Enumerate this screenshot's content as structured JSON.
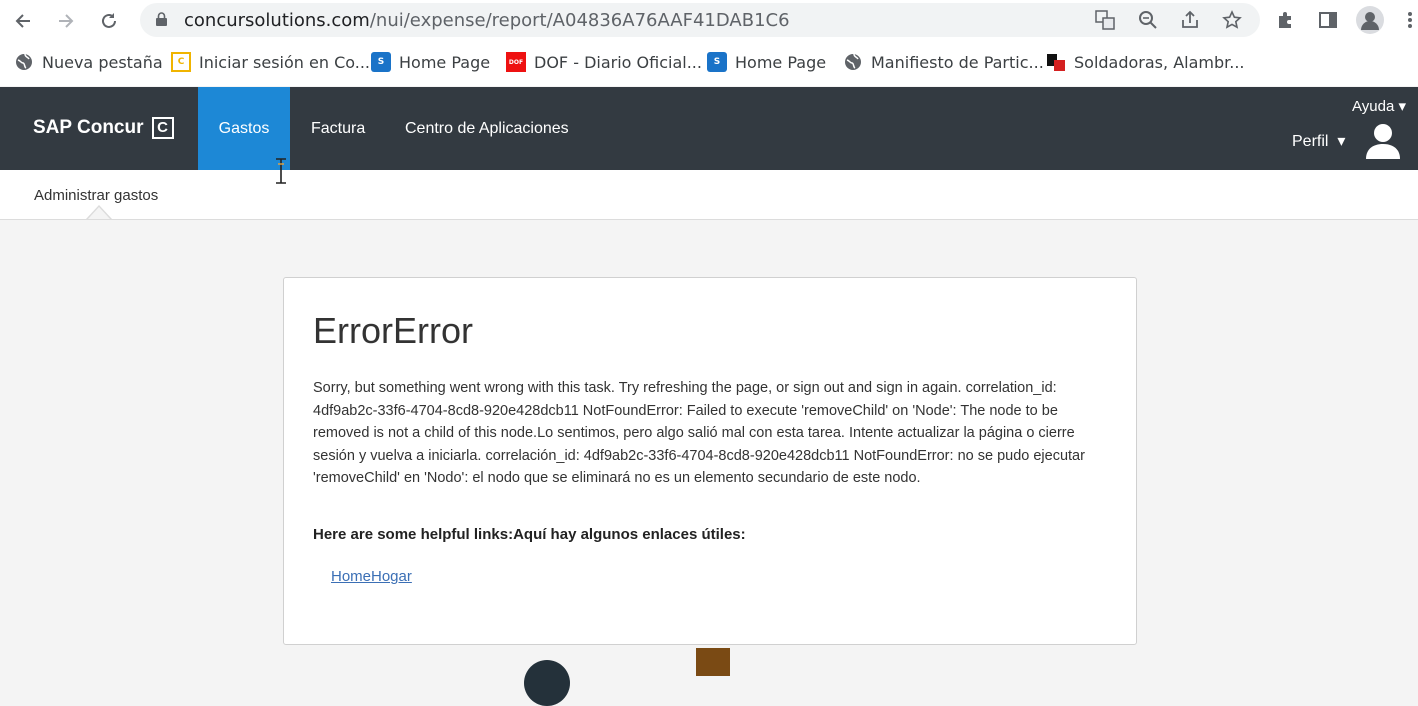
{
  "browser": {
    "url_domain": "concursolutions.com",
    "url_path": "/nui/expense/report/A04836A76AAF41DAB1C6",
    "bookmarks": [
      {
        "label": "Nueva pestaña",
        "icon": "globe-icon"
      },
      {
        "label": "Iniciar sesión en Co...",
        "icon": "concur-favicon",
        "icon_text": "C"
      },
      {
        "label": "Home Page",
        "icon": "sharepoint-icon",
        "icon_text": "S"
      },
      {
        "label": "DOF - Diario Oficial...",
        "icon": "dof-icon",
        "icon_text": "DOF"
      },
      {
        "label": "Home Page",
        "icon": "sharepoint-icon",
        "icon_text": "S"
      },
      {
        "label": "Manifiesto de Partic...",
        "icon": "globe-icon"
      },
      {
        "label": "Soldadoras, Alambr...",
        "icon": "store-icon"
      }
    ]
  },
  "header": {
    "brand": "SAP Concur",
    "brand_mark": "C",
    "nav": [
      "Gastos",
      "Factura",
      "Centro de Aplicaciones"
    ],
    "help": "Ayuda",
    "profile": "Perfil"
  },
  "subnav": {
    "item": "Administrar gastos"
  },
  "error": {
    "title": "ErrorError",
    "message": "Sorry, but something went wrong with this task. Try refreshing the page, or sign out and sign in again. correlation_id: 4df9ab2c-33f6-4704-8cd8-920e428dcb11 NotFoundError: Failed to execute 'removeChild' on 'Node': The node to be removed is not a child of this node.Lo sentimos, pero algo salió mal con esta tarea. Intente actualizar la página o cierre sesión y vuelva a iniciarla. correlación_id: 4df9ab2c-33f6-4704-8cd8-920e428dcb11 NotFoundError: no se pudo ejecutar 'removeChild' en 'Nodo': el nodo que se eliminará no es un elemento secundario de este nodo.",
    "links_heading": "Here are some helpful links:Aquí hay algunos enlaces útiles:",
    "link": "HomeHogar"
  },
  "colors": {
    "header_bg": "#333a41",
    "active_tab": "#1d88d6",
    "link": "#3b6fb5"
  }
}
